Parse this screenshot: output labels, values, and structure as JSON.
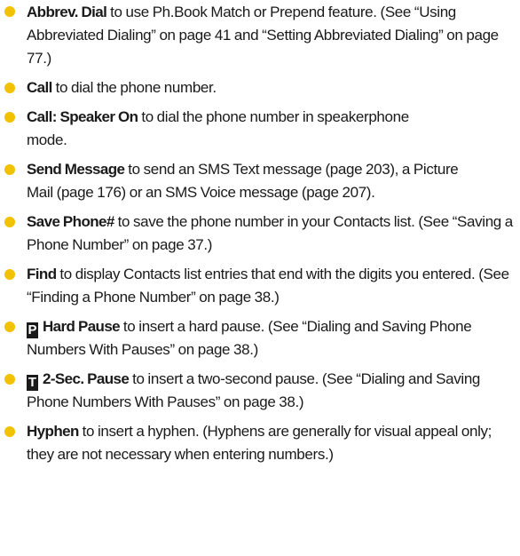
{
  "items": [
    {
      "term": "Abbrev. Dial",
      "text": " to use Ph.Book Match or Prepend feature. (See “Using Abbreviated Dialing” on page 41 and “Setting Abbreviated Dialing” on page 77.)"
    },
    {
      "term": "Call",
      "text": " to dial the phone number."
    },
    {
      "term": "Call: Speaker On",
      "text": " to dial the phone number in speakerphone mode."
    },
    {
      "term": "Send Message",
      "text": " to send an SMS Text message (page 203), a Picture Mail (page 176) or an SMS Voice message (page 207)."
    },
    {
      "term": "Save Phone#",
      "text": " to save the phone number in your Contacts list. (See “Saving a Phone Number” on page 37.)"
    },
    {
      "term": "Find",
      "text": " to display Contacts list entries that end with the digits you entered. (See “Finding a Phone Number” on page 38.)"
    },
    {
      "glyph": "P",
      "term": "Hard Pause",
      "text": " to insert a hard pause. (See “Dialing and Saving Phone Numbers With Pauses” on page 38.)"
    },
    {
      "glyph": "T",
      "term": "2-Sec. Pause",
      "text": " to insert a two-second pause. (See “Dialing and Saving Phone Numbers With Pauses” on page 38.)"
    },
    {
      "term": "Hyphen",
      "text": " to insert a hyphen. (Hyphens are generally for visual appeal only; they are not necessary when entering numbers.)"
    }
  ],
  "colors": {
    "bullet": "#f2c200",
    "text": "#1a1a1a",
    "glyph_background": "#1a1a1a"
  }
}
